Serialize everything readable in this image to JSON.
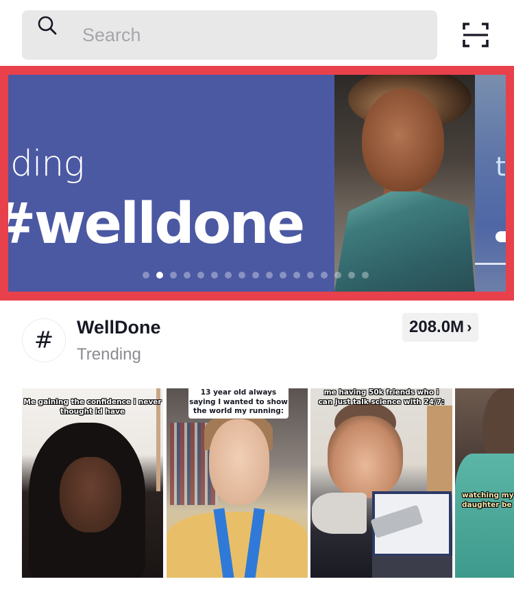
{
  "search": {
    "placeholder": "Search",
    "value": "",
    "icon": "search-icon"
  },
  "scan_button": {
    "icon": "scan-icon"
  },
  "banner": {
    "highlight_color": "#e8414b",
    "background_color": "#4b58a2",
    "slides": [
      {
        "kicker": "ending",
        "headline": "#welldone"
      },
      {
        "kicker": "t"
      }
    ],
    "dot_count": 17,
    "active_dot_index": 1
  },
  "hashtag": {
    "icon": "hashtag-icon",
    "symbol": "#",
    "title": "WellDone",
    "subtitle": "Trending",
    "views": "208.0M",
    "chevron": "›"
  },
  "videos": [
    {
      "caption": "Me gaining the confidence i never thought id have"
    },
    {
      "caption": "13 year old always saying I wanted to show the world my running:"
    },
    {
      "caption": "me having 50k friends who i can just talk science with 24/7:"
    },
    {
      "caption": "watching my daughter be her be"
    }
  ]
}
